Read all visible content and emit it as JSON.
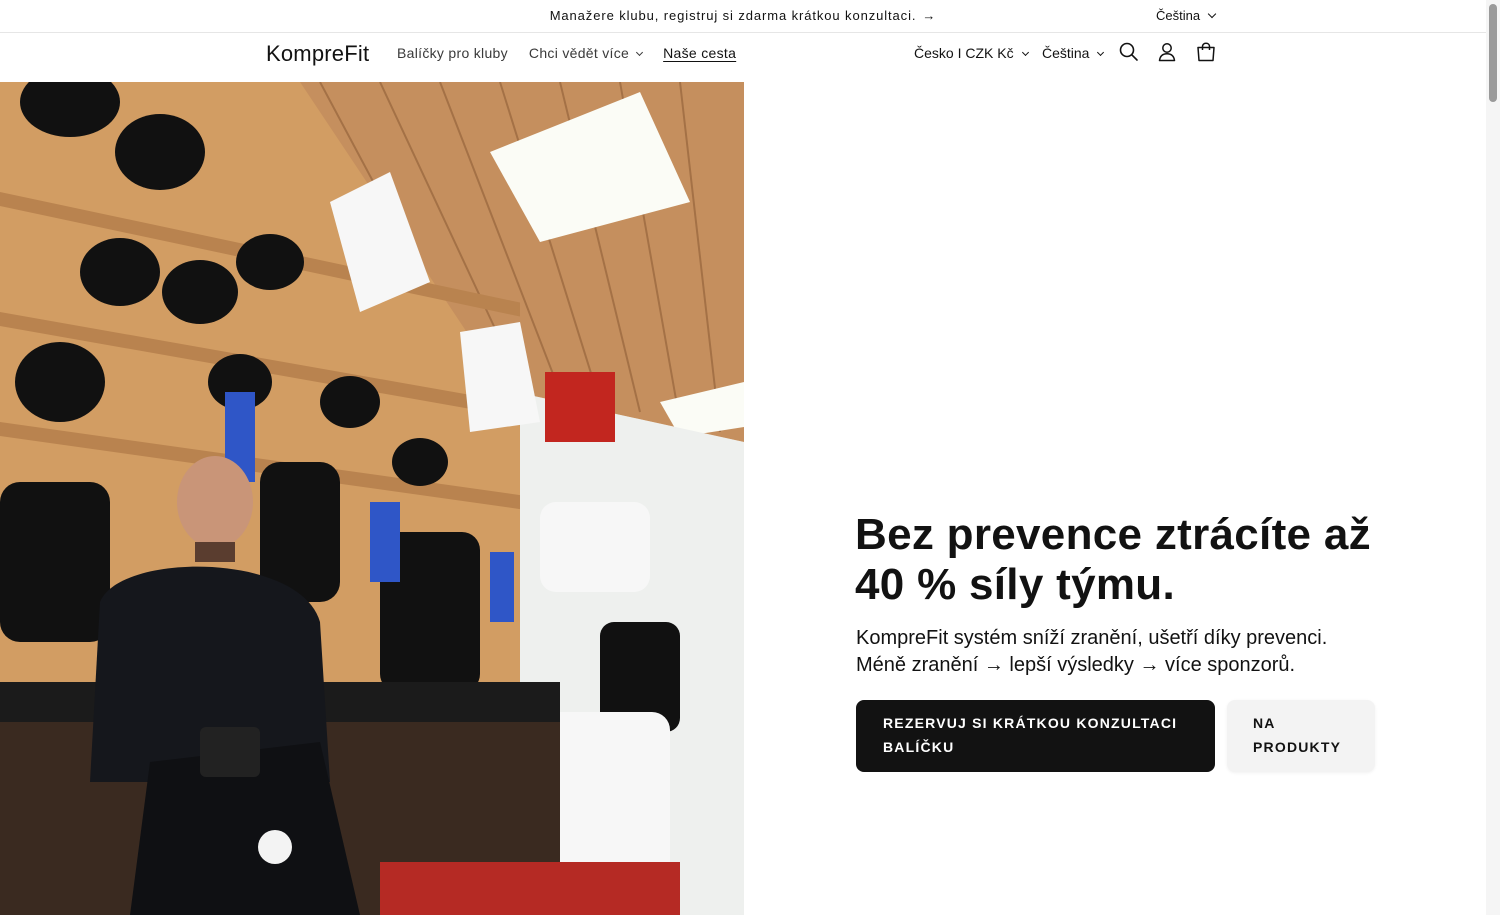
{
  "announcement": {
    "text": "Manažere klubu, registruj si zdarma krátkou konzultaci.",
    "arrow": "→",
    "language": "Čeština"
  },
  "header": {
    "logo": "KomprеFit",
    "nav": [
      {
        "label": "Balíčky pro kluby"
      },
      {
        "label": "Chci vědět více"
      },
      {
        "label": "Naše cesta"
      }
    ],
    "country_currency": "Česko I CZK Kč",
    "language": "Čeština",
    "icons": [
      "search-icon",
      "account-icon",
      "cart-icon"
    ]
  },
  "hero": {
    "image_alt": "Hráč v šatně s kompresními kalhoty KompreFit",
    "title": "Bez prevence ztrácíte až 40 % síly týmu.",
    "subtitle_line1": "KompreFit systém sníží zranění, ušetří díky prevenci.",
    "subtitle_line2": "Méně zranění → lepší výsledky → více sponzorů.",
    "primary_button": "REZERVUJ SI KRÁTKOU KONZULTACI BALÍČKU",
    "secondary_button": "NA PRODUKTY"
  },
  "colors": {
    "text": "#121212",
    "primary_button_bg": "#121212",
    "secondary_button_bg": "#f3f3f3"
  }
}
